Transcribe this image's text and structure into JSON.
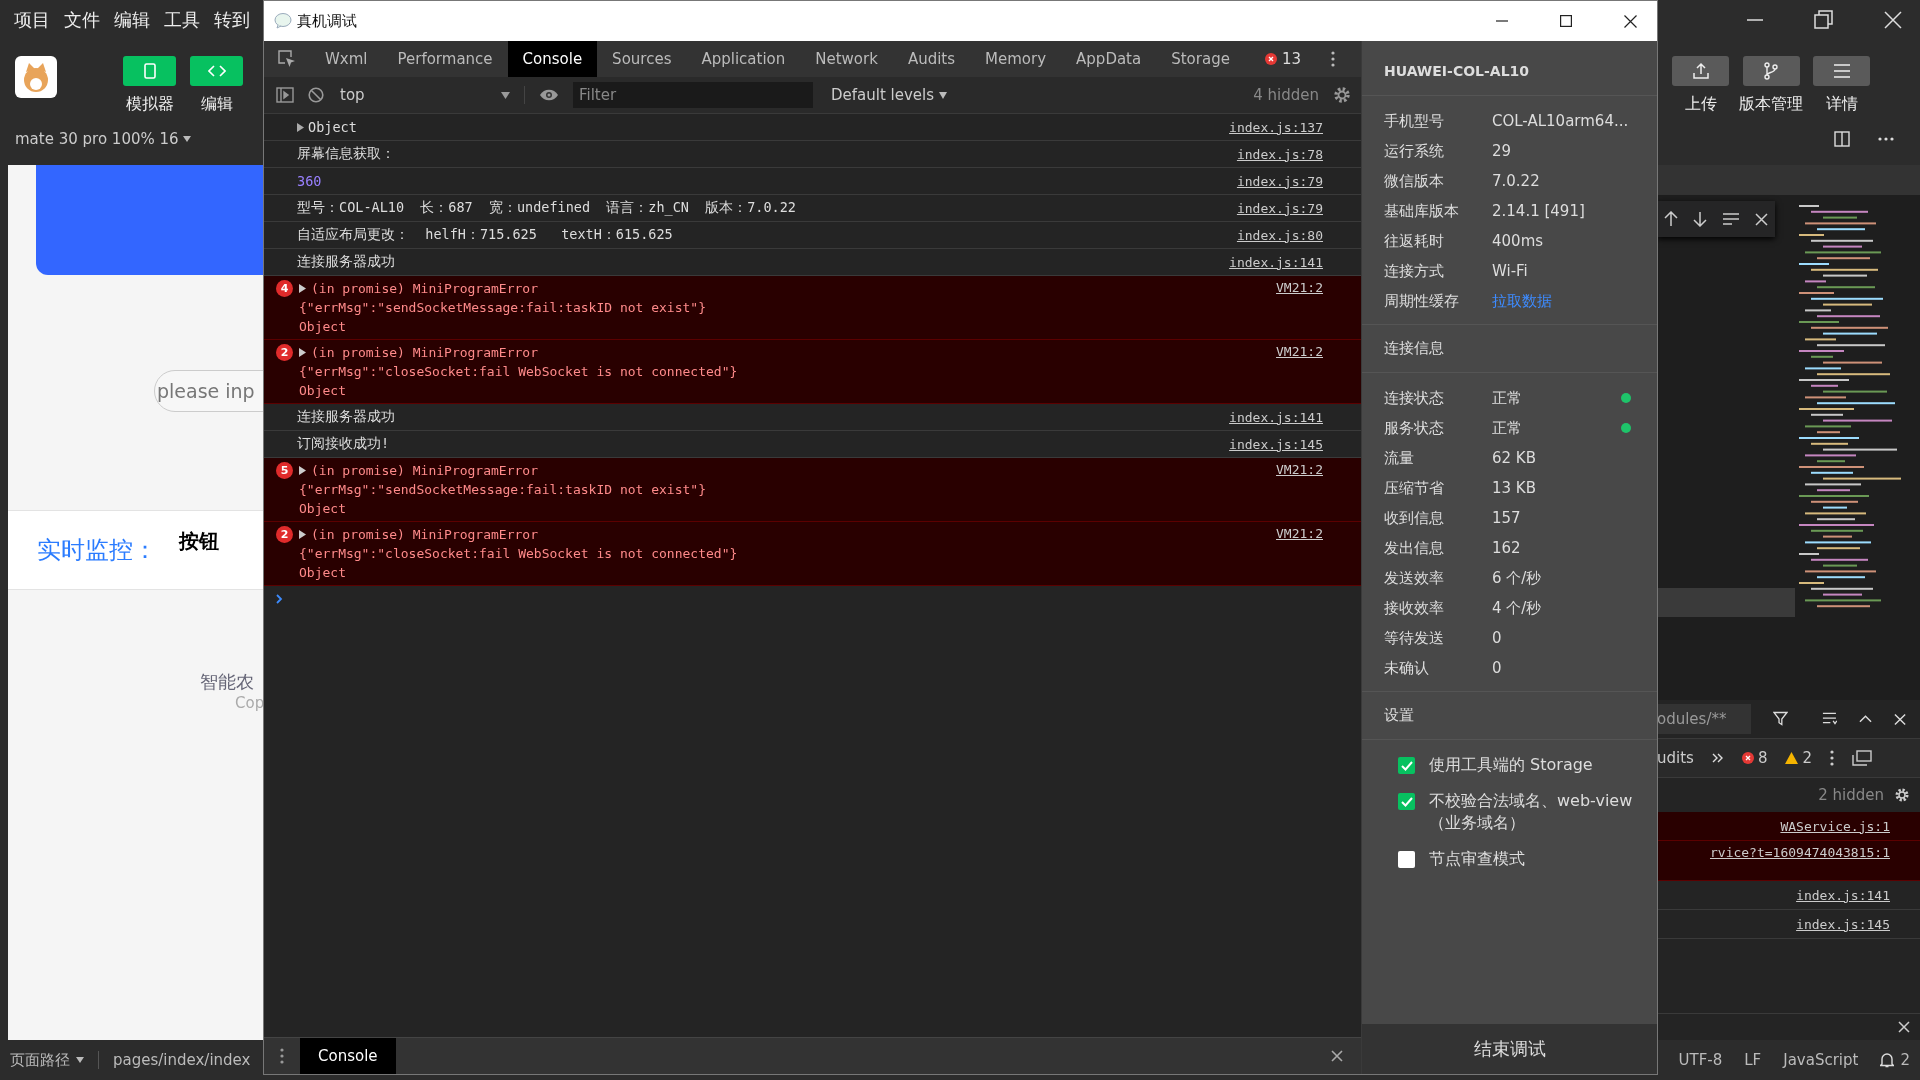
{
  "ide": {
    "menu": [
      "项目",
      "文件",
      "编辑",
      "工具",
      "转到"
    ],
    "left_tools": [
      {
        "label": "模拟器",
        "kind": "phone"
      },
      {
        "label": "编辑",
        "kind": "code"
      }
    ],
    "right_tools": [
      {
        "label": "上传",
        "kind": "upload"
      },
      {
        "label": "版本管理",
        "kind": "branch"
      },
      {
        "label": "详情",
        "kind": "menu"
      }
    ],
    "device_bar": "mate 30 pro 100% 16",
    "simulator": {
      "placeholder": "please inp",
      "monitor_label": "实时监控：",
      "monitor_button": "按钮",
      "footer_title": "智能农",
      "footer_copyright": "Cop"
    },
    "editor_devtools": {
      "filter": "odules/**",
      "tab": "udits",
      "errors": "8",
      "warnings": "2",
      "hidden": "2 hidden",
      "rows": [
        {
          "kind": "error",
          "source": "WAService.js:1"
        },
        {
          "kind": "error",
          "source": "rvice?t=1609474043815:1"
        },
        {
          "kind": "log",
          "source": "index.js:141"
        },
        {
          "kind": "log",
          "source": "index.js:145"
        }
      ]
    },
    "status_bar": {
      "path_label": "页面路径",
      "path": "pages/index/index",
      "encoding": "UTF-8",
      "line_ending": "LF",
      "language": "JavaScript",
      "notifications": "2"
    }
  },
  "debug_window": {
    "title": "真机调试",
    "tabs": [
      {
        "label": "Wxml",
        "selected": false
      },
      {
        "label": "Performance",
        "selected": false
      },
      {
        "label": "Console",
        "selected": true
      },
      {
        "label": "Sources",
        "selected": false
      },
      {
        "label": "Application",
        "selected": false
      },
      {
        "label": "Network",
        "selected": false
      },
      {
        "label": "Audits",
        "selected": false
      },
      {
        "label": "Memory",
        "selected": false
      },
      {
        "label": "AppData",
        "selected": false
      },
      {
        "label": "Storage",
        "selected": false
      }
    ],
    "error_count": "13",
    "context": "top",
    "filter_placeholder": "Filter",
    "levels": "Default levels",
    "hidden": "4 hidden",
    "console": [
      {
        "kind": "object",
        "text": "Object",
        "source": "index.js:137"
      },
      {
        "kind": "log",
        "text": "屏幕信息获取：",
        "source": "index.js:78"
      },
      {
        "kind": "number",
        "text": "360",
        "source": "index.js:79"
      },
      {
        "kind": "log",
        "text": "型号：COL-AL10  长：687  宽：undefined  语言：zh_CN  版本：7.0.22",
        "source": "index.js:79"
      },
      {
        "kind": "log",
        "text": "自适应布局更改：  helfH：715.625   textH：615.625",
        "source": "index.js:80"
      },
      {
        "kind": "log",
        "text": "连接服务器成功",
        "source": "index.js:141"
      },
      {
        "kind": "error",
        "count": "4",
        "title": "(in promise) MiniProgramError",
        "message": "{\"errMsg\":\"sendSocketMessage:fail:taskID not exist\"}",
        "detail": "Object",
        "source": "VM21:2"
      },
      {
        "kind": "error",
        "count": "2",
        "title": "(in promise) MiniProgramError",
        "message": "{\"errMsg\":\"closeSocket:fail WebSocket is not connected\"}",
        "detail": "Object",
        "source": "VM21:2"
      },
      {
        "kind": "log",
        "text": "连接服务器成功",
        "source": "index.js:141"
      },
      {
        "kind": "log",
        "text": "订阅接收成功!",
        "source": "index.js:145"
      },
      {
        "kind": "error",
        "count": "5",
        "title": "(in promise) MiniProgramError",
        "message": "{\"errMsg\":\"sendSocketMessage:fail:taskID not exist\"}",
        "detail": "Object",
        "source": "VM21:2"
      },
      {
        "kind": "error",
        "count": "2",
        "title": "(in promise) MiniProgramError",
        "message": "{\"errMsg\":\"closeSocket:fail WebSocket is not connected\"}",
        "detail": "Object",
        "source": "VM21:2"
      }
    ],
    "drawer_tab": "Console",
    "device": {
      "name": "HUAWEI-COL-AL10",
      "info": [
        {
          "label": "手机型号",
          "value": "COL-AL10arm64...",
          "kind": "text"
        },
        {
          "label": "运行系统",
          "value": "29",
          "kind": "text"
        },
        {
          "label": "微信版本",
          "value": "7.0.22",
          "kind": "text"
        },
        {
          "label": "基础库版本",
          "value": "2.14.1 [491]",
          "kind": "text"
        },
        {
          "label": "往返耗时",
          "value": "400ms",
          "kind": "text"
        },
        {
          "label": "连接方式",
          "value": "Wi-Fi",
          "kind": "text"
        },
        {
          "label": "周期性缓存",
          "value": "拉取数据",
          "kind": "link"
        }
      ],
      "connection_title": "连接信息",
      "connection": [
        {
          "label": "连接状态",
          "value": "正常",
          "color": "#1ec46a"
        },
        {
          "label": "服务状态",
          "value": "正常",
          "color": "#1ec46a"
        },
        {
          "label": "流量",
          "value": "62 KB"
        },
        {
          "label": "压缩节省",
          "value": "13 KB"
        },
        {
          "label": "收到信息",
          "value": "157"
        },
        {
          "label": "发出信息",
          "value": "162"
        },
        {
          "label": "发送效率",
          "value": "6 个/秒"
        },
        {
          "label": "接收效率",
          "value": "4 个/秒"
        },
        {
          "label": "等待发送",
          "value": "0"
        },
        {
          "label": "未确认",
          "value": "0"
        }
      ],
      "settings_title": "设置",
      "settings": [
        {
          "label": "使用工具端的 Storage",
          "checked": true
        },
        {
          "label": "不校验合法域名、web-view（业务域名）",
          "checked": true
        },
        {
          "label": "节点审查模式",
          "checked": false
        }
      ],
      "end_button": "结束调试"
    }
  }
}
